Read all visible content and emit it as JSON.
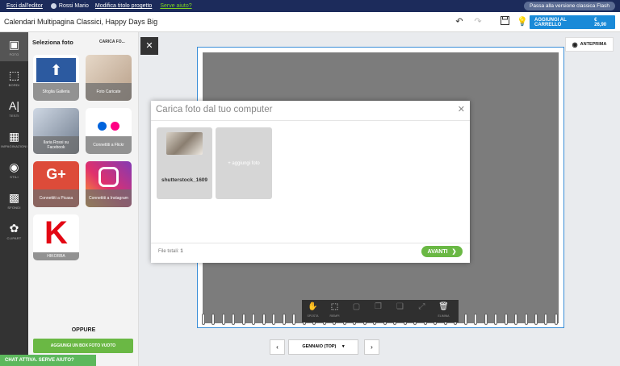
{
  "topbar": {
    "exit": "Esci dall'editor",
    "user": "Rossi Mario",
    "edit_title": "Modifica titolo progetto",
    "help": "Serve aiuto?",
    "flash": "Passa alla versione classica Flash"
  },
  "header": {
    "title": "Calendari Multipagina Classici, Happy Days Big",
    "cart_label": "AGGIUNGI AL CARRELLO",
    "price": "€ 26,90"
  },
  "iconbar": {
    "items": [
      {
        "label": "FOTO",
        "icon": "photo-icon"
      },
      {
        "label": "BORDI",
        "icon": "border-icon"
      },
      {
        "label": "TESTI",
        "icon": "text-icon"
      },
      {
        "label": "IMPAGINAZIONI",
        "icon": "layout-icon"
      },
      {
        "label": "STILI",
        "icon": "palette-icon"
      },
      {
        "label": "SFONDI",
        "icon": "background-icon"
      },
      {
        "label": "CLIPART",
        "icon": "clipart-icon"
      }
    ]
  },
  "panel": {
    "title": "Seleziona foto",
    "upload": "CARICA FO...",
    "tiles": [
      {
        "label": "Sfoglia Galleria",
        "color": "#2c5aa0"
      },
      {
        "label": "Foto Caricate",
        "color": "#c8b8a8"
      },
      {
        "label": "Ilaria Rossi su Facebook",
        "color": "#8a9bb4"
      },
      {
        "label": "Connettiti a Flickr",
        "color": "#ffffff"
      },
      {
        "label": "Connettiti a Picasa",
        "color": "#dd4b39"
      },
      {
        "label": "Connettiti a Instagram",
        "color": "#c13584"
      },
      {
        "label": "HIKORBA",
        "color": "#ffffff"
      }
    ],
    "oppure": "OPPURE",
    "add_box": "AGGIUNGI UN BOX FOTO VUOTO"
  },
  "chat": "CHAT ATTIVA. SERVE AIUTO?",
  "preview": "ANTEPRIMA",
  "modal": {
    "title": "Carica foto dal tuo computer",
    "file_name": "shutterstock_1609",
    "add_photo": "+ aggiungi foto",
    "total_label": "File totali:",
    "total": "1",
    "next": "AVANTI"
  },
  "toolbar": {
    "sposta": "SPOSTA",
    "riempi": "RIEMPI",
    "elimina": "ELIMINA"
  },
  "nav": {
    "month": "GENNAIO (TOP)"
  }
}
